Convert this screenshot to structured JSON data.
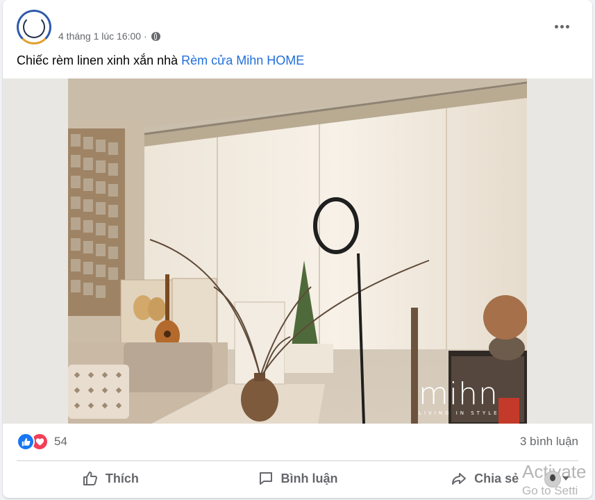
{
  "post": {
    "timestamp": "4 tháng 1 lúc 16:00",
    "separator": "·",
    "caption_text": "Chiếc rèm linen xinh xắn nhà ",
    "caption_link": "Rèm cửa Mihn HOME",
    "more_icon": "more-dots-icon",
    "privacy_icon": "globe-icon"
  },
  "photo": {
    "watermark_logo": "mihn",
    "watermark_tagline": "LIVING IN STYLE"
  },
  "stats": {
    "reaction_icons": [
      "like-icon",
      "love-icon"
    ],
    "reaction_count": "54",
    "comment_count": "3 bình luận"
  },
  "actions": {
    "like_label": "Thích",
    "comment_label": "Bình luận",
    "share_label": "Chia sẻ"
  },
  "overlay": {
    "activate_text": "Activate",
    "activate_sub": "Go to Setti"
  },
  "colors": {
    "link": "#216fdb",
    "muted": "#65676b",
    "like": "#1877f2",
    "love": "#f33e58"
  }
}
